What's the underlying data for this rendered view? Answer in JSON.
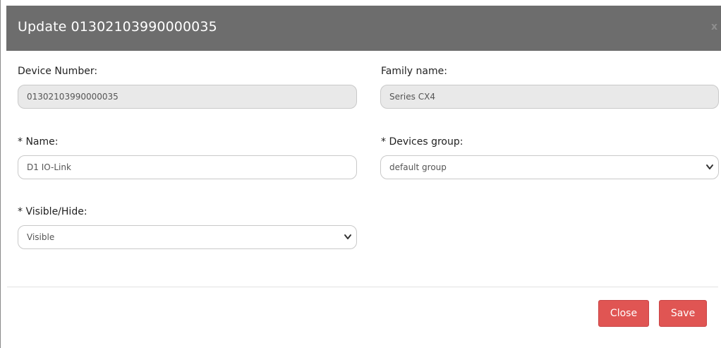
{
  "modal": {
    "title": "Update 01302103990000035",
    "close_glyph": "x"
  },
  "fields": {
    "device_number": {
      "label": "Device Number:",
      "value": "01302103990000035"
    },
    "family_name": {
      "label": "Family name:",
      "value": "Series CX4"
    },
    "name": {
      "label": "* Name:",
      "value": "D1 IO-Link"
    },
    "devices_group": {
      "label": "* Devices group:",
      "value": "default group"
    },
    "visible_hide": {
      "label": "* Visible/Hide:",
      "value": "Visible"
    }
  },
  "footer": {
    "close_label": "Close",
    "save_label": "Save"
  },
  "colors": {
    "header_bg": "#6d6d6d",
    "button_bg": "#e05553",
    "readonly_bg": "#e9e9e9"
  }
}
